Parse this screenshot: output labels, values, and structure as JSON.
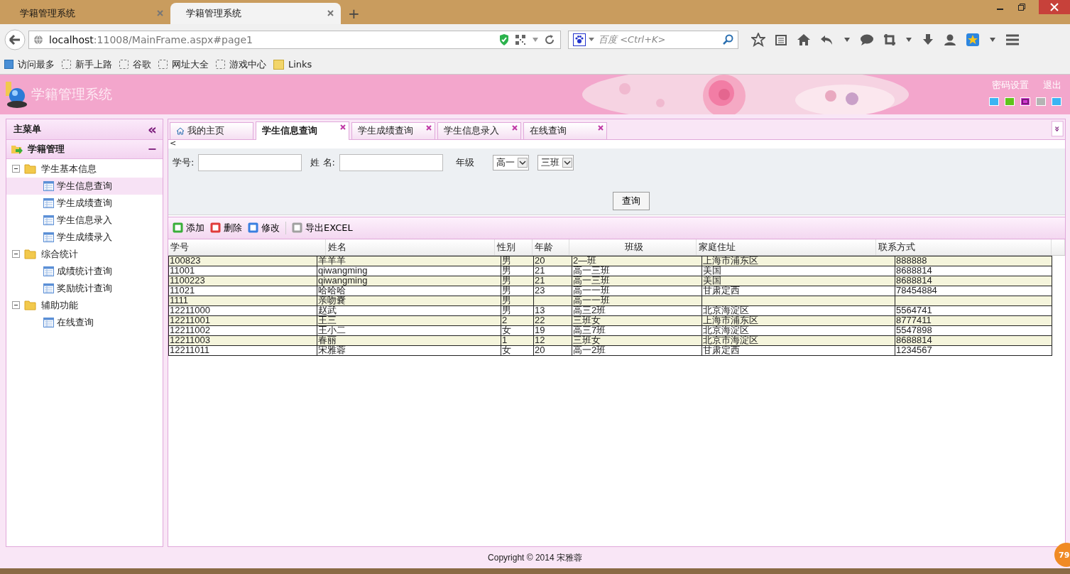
{
  "browser": {
    "tabs": [
      {
        "title": "学籍管理系统",
        "selected": false
      },
      {
        "title": "学籍管理系统",
        "selected": true
      }
    ],
    "new_tab": "+",
    "url": {
      "host": "localhost",
      "rest": ":11008/MainFrame.aspx#page1"
    },
    "search": {
      "placeholder": "百度 <Ctrl+K>"
    },
    "bookmarks": [
      {
        "label": "访问最多",
        "kind": "search"
      },
      {
        "label": "新手上路",
        "kind": "page"
      },
      {
        "label": "谷歌",
        "kind": "page"
      },
      {
        "label": "网址大全",
        "kind": "page"
      },
      {
        "label": "游戏中心",
        "kind": "page"
      },
      {
        "label": "Links",
        "kind": "folder"
      }
    ]
  },
  "header": {
    "title": "学籍管理系统",
    "links": [
      "密码设置",
      "退出"
    ],
    "themes": [
      {
        "color": "#3bb4f2",
        "selected": false
      },
      {
        "color": "#5ec41a",
        "selected": false
      },
      {
        "color": "#d13ad0",
        "selected": true
      },
      {
        "color": "#b4b4b4",
        "selected": false
      },
      {
        "color": "#3bb4f2",
        "selected": false
      }
    ]
  },
  "sidebar": {
    "title": "主菜单",
    "collapse": "«",
    "section": "学籍管理",
    "section_toggle": "−",
    "tree": [
      {
        "label": "学生基本信息",
        "expanded": true,
        "children": [
          {
            "label": "学生信息查询",
            "selected": true
          },
          {
            "label": "学生成绩查询",
            "selected": false
          },
          {
            "label": "学生信息录入",
            "selected": false
          },
          {
            "label": "学生成绩录入",
            "selected": false
          }
        ]
      },
      {
        "label": "综合统计",
        "expanded": true,
        "children": [
          {
            "label": "成绩统计查询",
            "selected": false
          },
          {
            "label": "奖励统计查询",
            "selected": false
          }
        ]
      },
      {
        "label": "辅助功能",
        "expanded": true,
        "children": [
          {
            "label": "在线查询",
            "selected": false
          }
        ]
      }
    ]
  },
  "tabs": [
    {
      "label": "我的主页",
      "selected": false,
      "closable": false,
      "kind": "home"
    },
    {
      "label": "学生信息查询",
      "selected": true,
      "closable": true
    },
    {
      "label": "学生成绩查询",
      "selected": false,
      "closable": true
    },
    {
      "label": "学生信息录入",
      "selected": false,
      "closable": true
    },
    {
      "label": "在线查询",
      "selected": false,
      "closable": true
    }
  ],
  "tabs_menu": "»",
  "back_mark": "<",
  "search_form": {
    "fields": [
      {
        "label": "学号:"
      },
      {
        "label": "姓 名:"
      }
    ],
    "grade": {
      "label": "年级",
      "value": "高一"
    },
    "class_select": {
      "value": "三班"
    },
    "submit": "查询"
  },
  "toolbar": [
    {
      "label": "添加",
      "kind": "add"
    },
    {
      "label": "删除",
      "kind": "delete"
    },
    {
      "label": "修改",
      "kind": "edit"
    },
    {
      "label": "导出EXCEL",
      "kind": "export"
    }
  ],
  "table": {
    "columns": [
      "学号",
      "姓名",
      "性别",
      "年龄",
      "班级",
      "家庭住址",
      "联系方式"
    ],
    "rows": [
      [
        "100823",
        "羊羊羊",
        "男",
        "20",
        "2—班",
        "上海市浦东区",
        "888888"
      ],
      [
        "11001",
        "qiwangming",
        "男",
        "21",
        "高一三班",
        "美国",
        "8688814"
      ],
      [
        "1100223",
        "qiwangming",
        "男",
        "21",
        "高一三班",
        "美国",
        "8688814"
      ],
      [
        "11021",
        "哈哈哈",
        "男",
        "23",
        "高一一班",
        "甘肃定西",
        "78454884"
      ],
      [
        "1111",
        "亲吻嚢",
        "男",
        "",
        "高一一班",
        "",
        ""
      ],
      [
        "12211000",
        "赵武",
        "男",
        "13",
        "高三2班",
        "北京海淀区",
        "5564741"
      ],
      [
        "12211001",
        "王三",
        "2",
        "22",
        "三班女",
        "上海市浦东区",
        "8777411"
      ],
      [
        "12211002",
        "王小二",
        "女",
        "19",
        "高三7班",
        "北京海淀区",
        "5547898"
      ],
      [
        "12211003",
        "春丽",
        "1",
        "12",
        "三班女",
        "北京市海淀区",
        "8688814"
      ],
      [
        "12211011",
        "宋雅蓉",
        "女",
        "20",
        "高一2班",
        "甘肃定西",
        "1234567"
      ]
    ]
  },
  "footer": "Copyright © 2014 宋雅蓉",
  "corner_badge": "79"
}
